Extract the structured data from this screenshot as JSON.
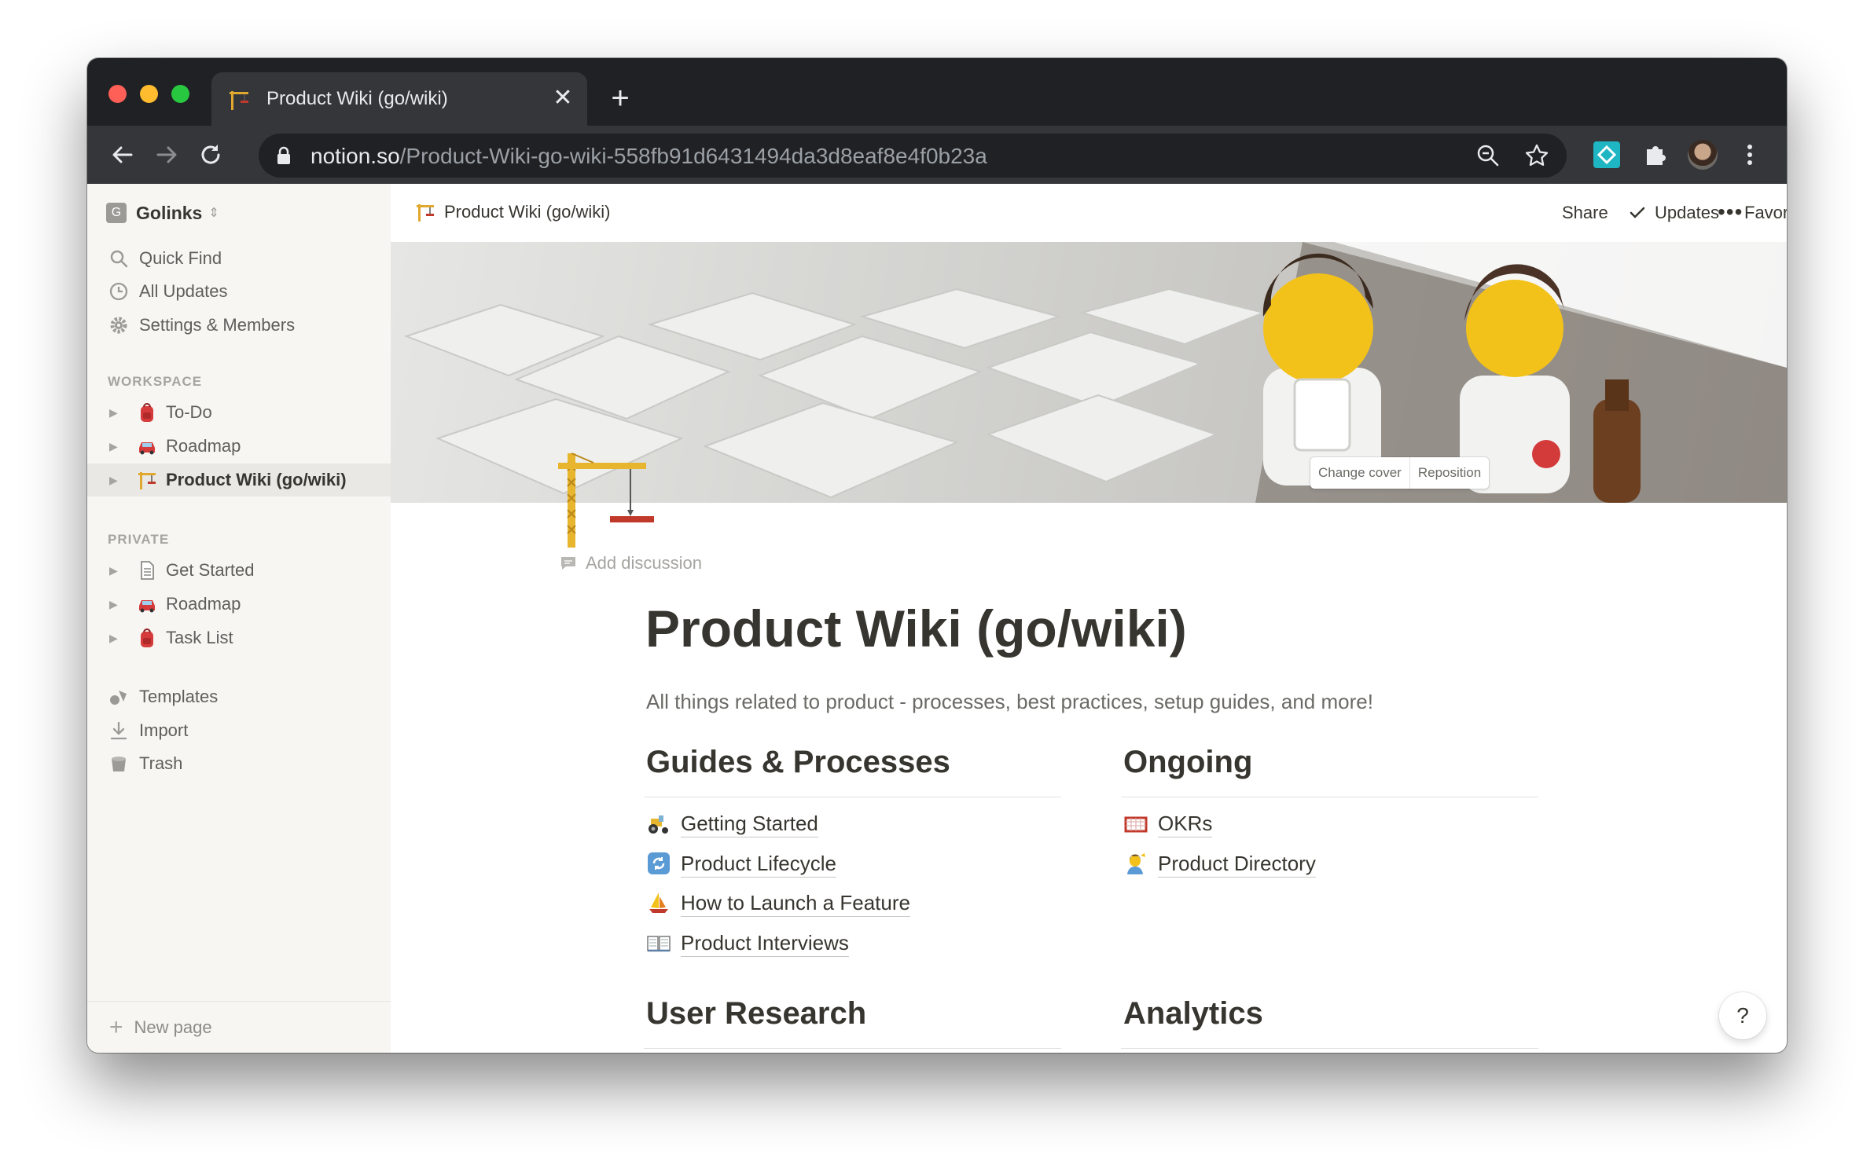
{
  "browser": {
    "tab_title": "Product Wiki (go/wiki)",
    "tab_close": "✕",
    "new_tab": "+",
    "url_host": "notion.so",
    "url_path": "/Product-Wiki-go-wiki-558fb91d6431494da3d8eaf8e4f0b23a"
  },
  "sidebar": {
    "workspace_badge": "G",
    "workspace_name": "Golinks",
    "workspace_chevron": "⇕",
    "actions": [
      {
        "label": "Quick Find",
        "icon": "search-icon"
      },
      {
        "label": "All Updates",
        "icon": "clock-icon"
      },
      {
        "label": "Settings & Members",
        "icon": "gear-icon"
      }
    ],
    "workspace_section": "WORKSPACE",
    "workspace_pages": [
      {
        "label": "To-Do",
        "icon": "backpack-icon"
      },
      {
        "label": "Roadmap",
        "icon": "car-icon"
      },
      {
        "label": "Product Wiki (go/wiki)",
        "icon": "crane-icon"
      }
    ],
    "private_section": "PRIVATE",
    "private_pages": [
      {
        "label": "Get Started",
        "icon": "document-icon"
      },
      {
        "label": "Roadmap",
        "icon": "car-icon"
      },
      {
        "label": "Task List",
        "icon": "backpack-icon"
      }
    ],
    "tools": [
      {
        "label": "Templates",
        "icon": "templates-icon"
      },
      {
        "label": "Import",
        "icon": "download-icon"
      },
      {
        "label": "Trash",
        "icon": "trash-icon"
      }
    ],
    "new_page_icon": "+",
    "new_page": "New page"
  },
  "topbar": {
    "breadcrumb": "Product Wiki (go/wiki)",
    "share": "Share",
    "updates": "Updates",
    "favorite": "Favorite",
    "more": "•••"
  },
  "cover": {
    "change_cover": "Change cover",
    "reposition": "Reposition"
  },
  "page": {
    "add_discussion": "Add discussion",
    "title": "Product Wiki (go/wiki)",
    "description": "All things related to product - processes, best practices, setup guides, and more!",
    "columns": [
      {
        "heading": "Guides & Processes",
        "links": [
          {
            "label": "Getting Started",
            "icon": "tractor-icon"
          },
          {
            "label": "Product Lifecycle",
            "icon": "cycle-icon"
          },
          {
            "label": "How to Launch a Feature",
            "icon": "sailboat-icon"
          },
          {
            "label": "Product Interviews",
            "icon": "book-icon"
          }
        ]
      },
      {
        "heading": "Ongoing",
        "links": [
          {
            "label": "OKRs",
            "icon": "goal-icon"
          },
          {
            "label": "Product Directory",
            "icon": "person-icon"
          }
        ]
      }
    ],
    "lower_headings": [
      "User Research",
      "Analytics"
    ]
  },
  "help": "?",
  "colors": {
    "sidebar_bg": "#f7f6f3",
    "text": "#37352f",
    "chrome_dark": "#202124",
    "chrome_toolbar": "#35363a"
  }
}
